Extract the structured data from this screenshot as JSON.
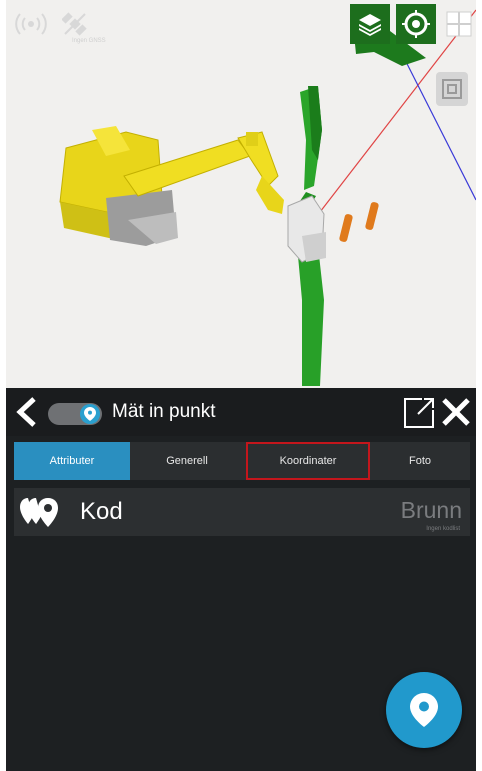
{
  "status_icons": {
    "signal": "wireless-signal-icon",
    "satellite": "satellite-off-icon",
    "satellite_caption": "Ingen GNSS"
  },
  "toolbar_icons": [
    "layers-icon",
    "target-icon",
    "layout-icon",
    "view-3d-icon"
  ],
  "header": {
    "back_icon": "chevron-left-icon",
    "title": "Mät in punkt",
    "toggle_icon": "location-pin-icon",
    "external_icon": "external-link-icon",
    "close_icon": "close-icon"
  },
  "tabs": [
    {
      "label": "Attributer",
      "active": true,
      "highlighted": false
    },
    {
      "label": "Generell",
      "active": false,
      "highlighted": false
    },
    {
      "label": "Koordinater",
      "active": false,
      "highlighted": true
    },
    {
      "label": "Foto",
      "active": false,
      "highlighted": false
    }
  ],
  "attribute_row": {
    "icon": "multi-pin-icon",
    "label": "Kod",
    "value": "Brunn",
    "sub_value": "Ingen kodlist"
  },
  "fab": {
    "icon": "location-pin-icon"
  },
  "colors": {
    "accent": "#2a8fc0",
    "highlight_border": "#c4161c",
    "panel_bg": "#1d2022"
  }
}
